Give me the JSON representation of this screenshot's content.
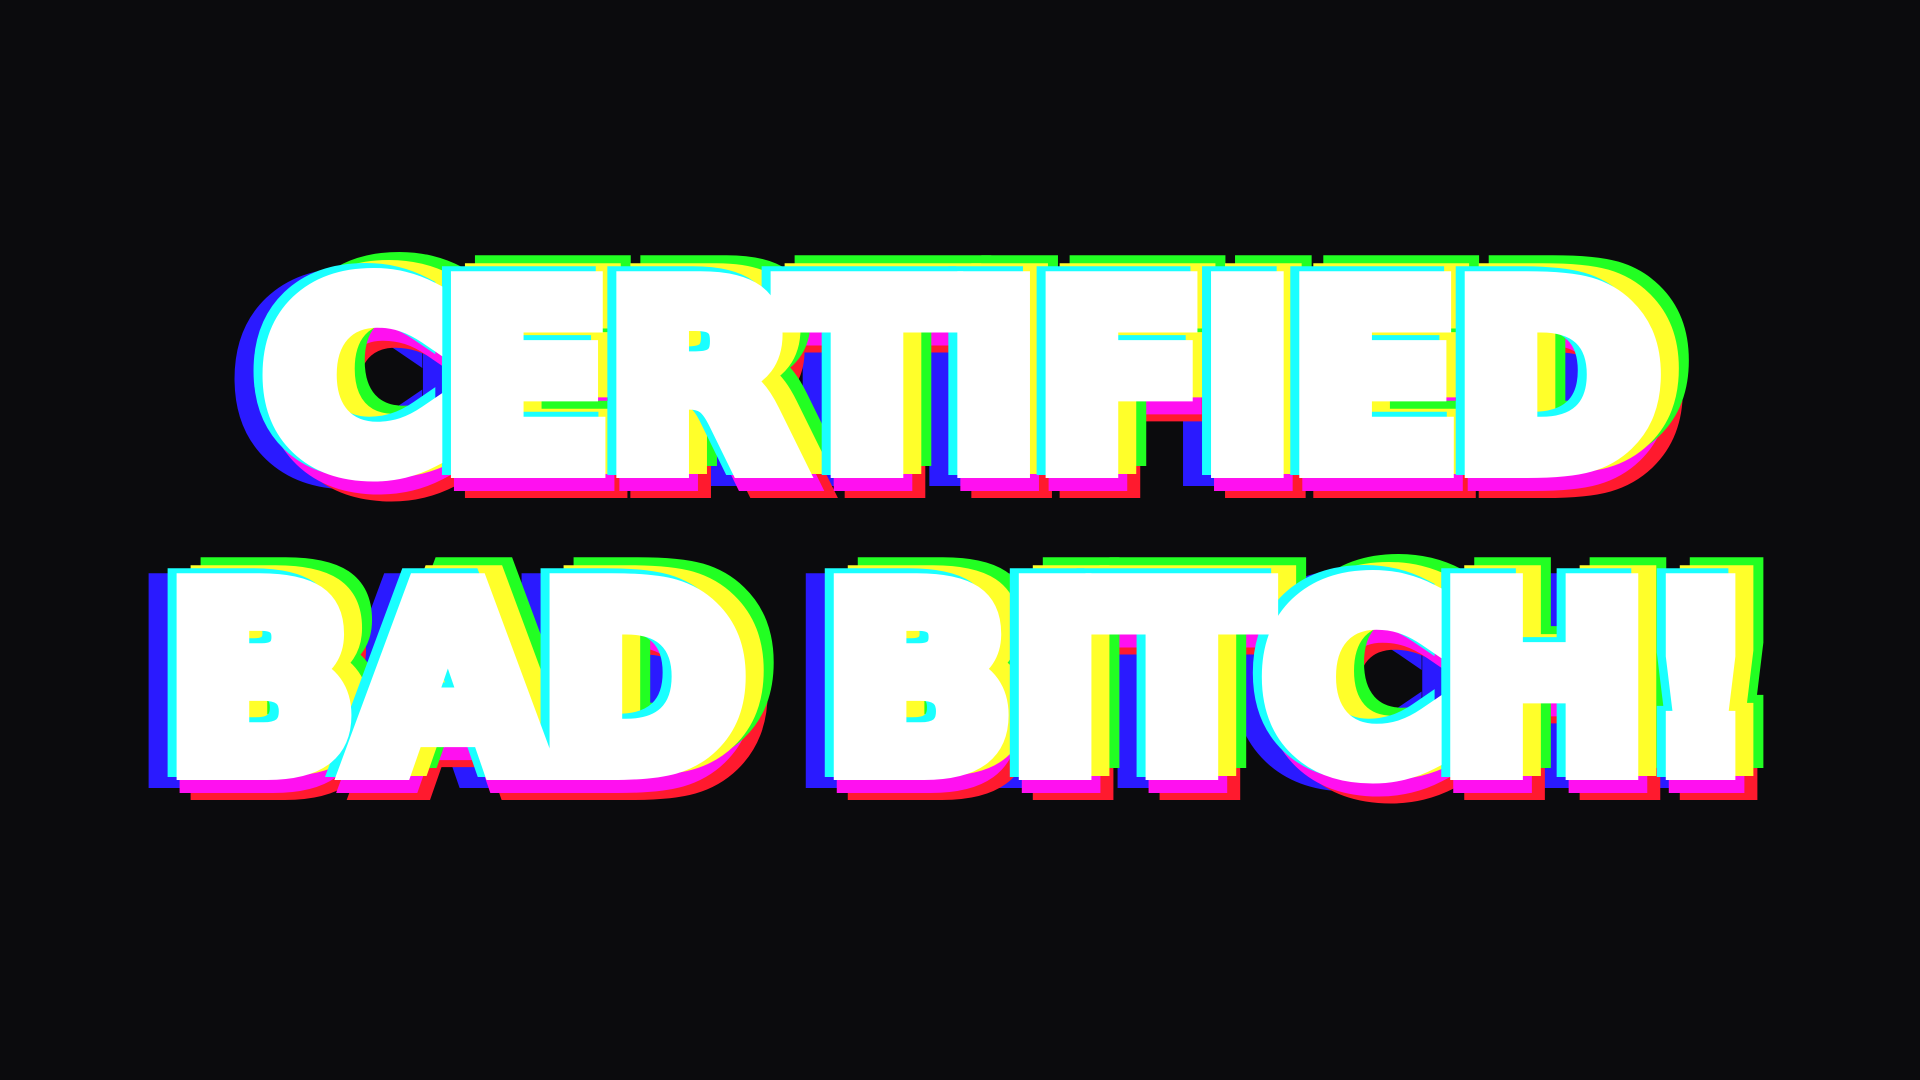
{
  "slogan": {
    "line1": "CERTIFIED",
    "line2": "BAD BITCH!"
  },
  "colors": {
    "background": "#0b0b0d",
    "text": "#ffffff",
    "glitch_red": "#ff1a2e",
    "glitch_blue": "#2a1aff",
    "glitch_magenta": "#ff10f0",
    "glitch_yellow": "#ffff2a",
    "glitch_green": "#22ff22",
    "glitch_cyan": "#1affff"
  }
}
